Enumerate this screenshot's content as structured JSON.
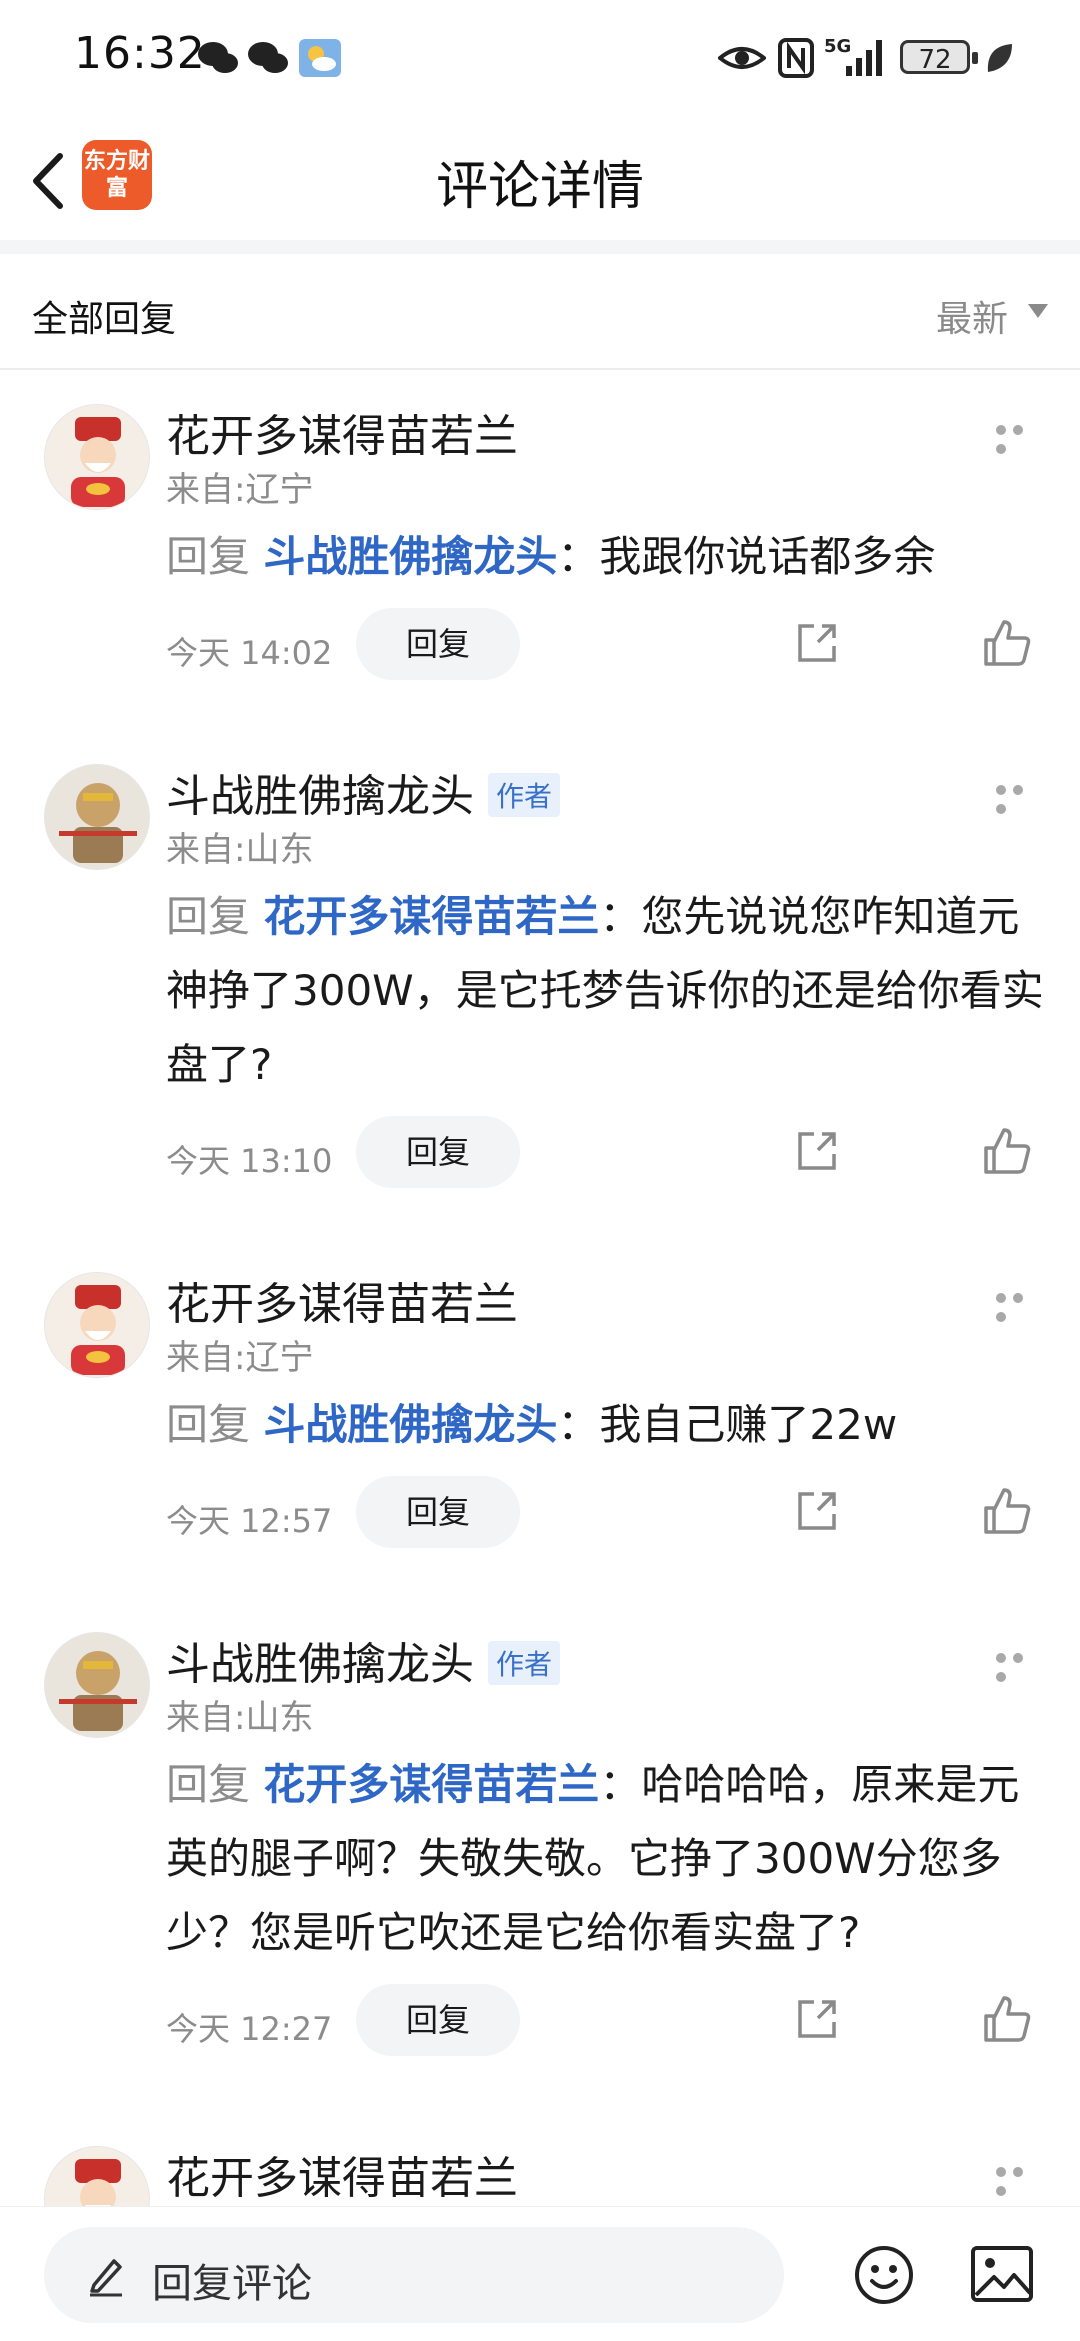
{
  "status_bar": {
    "time": "16:32",
    "battery": "72",
    "signal": "5G"
  },
  "header": {
    "title": "评论详情",
    "logo_text": "东方财富"
  },
  "filter": {
    "left_label": "全部回复",
    "sort_label": "最新"
  },
  "comments": [
    {
      "user": "花开多谋得苗若兰",
      "is_author": false,
      "origin": "来自:辽宁",
      "reply_word": "回复",
      "reply_to": "斗战胜佛擒龙头",
      "text": "：我跟你说话都多余",
      "time": "今天 14:02",
      "reply_label": "回复"
    },
    {
      "user": "斗战胜佛擒龙头",
      "is_author": true,
      "author_label": "作者",
      "origin": "来自:山东",
      "reply_word": "回复",
      "reply_to": "花开多谋得苗若兰",
      "text": "：您先说说您咋知道元神挣了300W，是它托梦告诉你的还是给你看实盘了?",
      "time": "今天 13:10",
      "reply_label": "回复"
    },
    {
      "user": "花开多谋得苗若兰",
      "is_author": false,
      "origin": "来自:辽宁",
      "reply_word": "回复",
      "reply_to": "斗战胜佛擒龙头",
      "text": "：我自己赚了22w",
      "time": "今天 12:57",
      "reply_label": "回复"
    },
    {
      "user": "斗战胜佛擒龙头",
      "is_author": true,
      "author_label": "作者",
      "origin": "来自:山东",
      "reply_word": "回复",
      "reply_to": "花开多谋得苗若兰",
      "text": "：哈哈哈哈，原来是元英的腿子啊？失敬失敬。它挣了300W分您多少？您是听它吹还是它给你看实盘了?",
      "time": "今天 12:27",
      "reply_label": "回复"
    },
    {
      "user": "花开多谋得苗若兰",
      "is_author": false
    }
  ],
  "bottom_bar": {
    "placeholder": "回复评论"
  },
  "colors": {
    "link_blue": "#2f67c7",
    "logo_orange": "#ee5b2a",
    "muted_gray": "#8c8c8c"
  }
}
